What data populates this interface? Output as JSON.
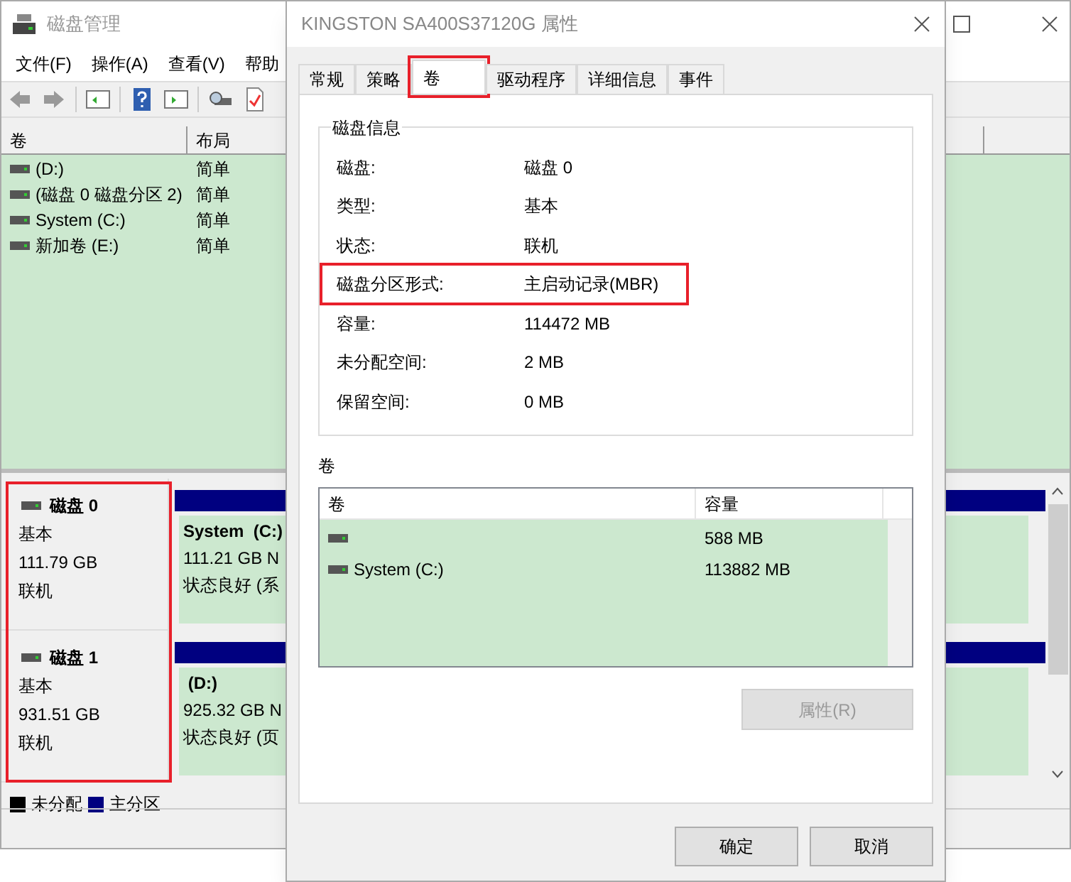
{
  "main_window": {
    "title": "磁盘管理",
    "menu": [
      "文件(F)",
      "操作(A)",
      "查看(V)",
      "帮助"
    ],
    "volume_list": {
      "columns": [
        "卷",
        "布局"
      ],
      "rows": [
        {
          "volume": "(D:)",
          "layout": "简单"
        },
        {
          "volume": "(磁盘 0 磁盘分区 2)",
          "layout": "简单"
        },
        {
          "volume": "System (C:)",
          "layout": "简单"
        },
        {
          "volume": "新加卷 (E:)",
          "layout": "简单"
        }
      ]
    },
    "disks_highlighted": true,
    "disks": [
      {
        "name": "磁盘 0",
        "type": "基本",
        "size": "111.79 GB",
        "status": "联机",
        "partition": {
          "name": "System  (C:)",
          "size": "111.21 GB N",
          "status": "状态良好 (系"
        }
      },
      {
        "name": "磁盘 1",
        "type": "基本",
        "size": "931.51 GB",
        "status": "联机",
        "partition": {
          "name": " (D:)",
          "size": "925.32 GB N",
          "status": "状态良好 (页"
        }
      }
    ],
    "legend": [
      {
        "label": "未分配",
        "color": "#000000"
      },
      {
        "label": "主分区",
        "color": "#000080"
      }
    ]
  },
  "dialog": {
    "title": "KINGSTON SA400S37120G 属性",
    "tabs": [
      {
        "label": "常规",
        "selected": false,
        "highlighted": false
      },
      {
        "label": "策略",
        "selected": false,
        "highlighted": false
      },
      {
        "label": "卷",
        "selected": true,
        "highlighted": true
      },
      {
        "label": "驱动程序",
        "selected": false,
        "highlighted": false
      },
      {
        "label": "详细信息",
        "selected": false,
        "highlighted": false
      },
      {
        "label": "事件",
        "selected": false,
        "highlighted": false
      }
    ],
    "disk_info": {
      "title": "磁盘信息",
      "rows": [
        {
          "label": "磁盘:",
          "value": "磁盘 0",
          "highlighted": false
        },
        {
          "label": "类型:",
          "value": "基本",
          "highlighted": false
        },
        {
          "label": "状态:",
          "value": "联机",
          "highlighted": false
        },
        {
          "label": "磁盘分区形式:",
          "value": "主启动记录(MBR)",
          "highlighted": true
        },
        {
          "label": "容量:",
          "value": "114472 MB",
          "highlighted": false
        },
        {
          "label": "未分配空间:",
          "value": "2 MB",
          "highlighted": false
        },
        {
          "label": "保留空间:",
          "value": "0 MB",
          "highlighted": false
        }
      ]
    },
    "volumes": {
      "title": "卷",
      "columns": [
        "卷",
        "容量"
      ],
      "rows": [
        {
          "capacity": "588 MB"
        },
        {
          "volume": "System (C:)",
          "capacity": "113882 MB"
        }
      ]
    },
    "properties_button": {
      "label": "属性(R)",
      "disabled": true
    },
    "buttons": [
      "确定",
      "取消"
    ]
  }
}
